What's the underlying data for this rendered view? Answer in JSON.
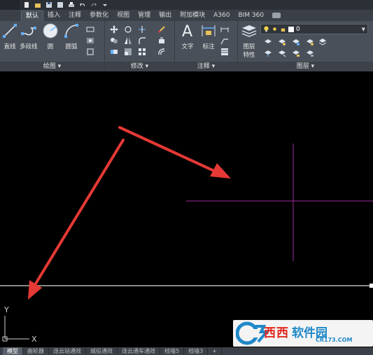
{
  "ribbon_tabs": [
    "默认",
    "插入",
    "注释",
    "参数化",
    "视图",
    "管理",
    "输出",
    "附加模块",
    "A360",
    "BIM 360"
  ],
  "active_tab": "默认",
  "panels": {
    "draw": {
      "title": "绘图 ▾",
      "line": "直线",
      "polyline": "多段线",
      "circle": "圆",
      "arc": "圆弧"
    },
    "modify": {
      "title": "修改 ▾"
    },
    "annotation": {
      "title": "注释 ▾",
      "text": "文字",
      "dimension": "标注"
    },
    "layers": {
      "title": "图层 ▾",
      "properties_line1": "图层",
      "properties_line2": "特性",
      "current_layer": "0"
    }
  },
  "ucs": {
    "y_label": "Y",
    "x_label": "X"
  },
  "layout_tabs": [
    "模型",
    "曲轮器",
    "连云站通效",
    "城役通效",
    "连云通车通效",
    "档墙5",
    "档墙3",
    "+"
  ],
  "active_layout": "模型",
  "watermark": {
    "brand": "西西",
    "name": "软件园",
    "url": "CR173.COM"
  },
  "colors": {
    "crosshair": "#9c2a9c",
    "arrow": "#e53935",
    "ribbon": "#4a5059",
    "canvas": "#000000"
  }
}
